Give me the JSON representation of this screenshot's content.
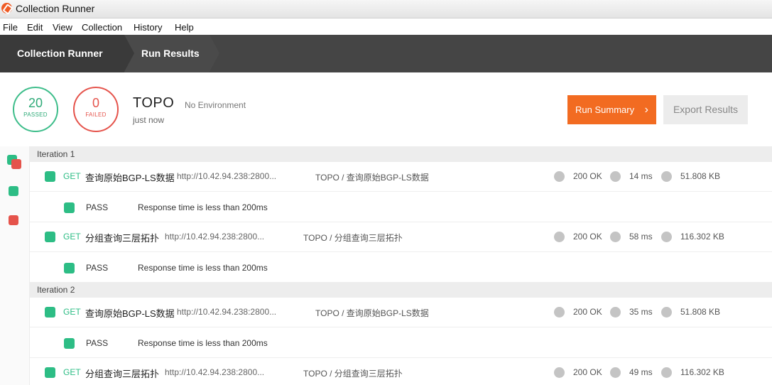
{
  "window": {
    "title": "Collection Runner"
  },
  "menu": [
    "File",
    "Edit",
    "View",
    "Collection",
    "History",
    "Help"
  ],
  "breadcrumbs": [
    "Collection Runner",
    "Run Results"
  ],
  "summary": {
    "passed_count": "20",
    "passed_label": "PASSED",
    "failed_count": "0",
    "failed_label": "FAILED",
    "collection": "TOPO",
    "environment": "No Environment",
    "time": "just now",
    "run_summary_label": "Run Summary",
    "export_label": "Export Results"
  },
  "colors": {
    "accent": "#f26b21",
    "pass": "#2dbd85",
    "fail": "#e5534b",
    "header": "#454545"
  },
  "iterations": [
    {
      "label": "Iteration 1",
      "requests": [
        {
          "method": "GET",
          "name": "查询原始BGP-LS数据",
          "url": "http://10.42.94.238:2800...",
          "path": "TOPO / 查询原始BGP-LS数据",
          "status": "200 OK",
          "time": "14 ms",
          "size": "51.808 KB",
          "test": {
            "result": "PASS",
            "desc": "Response time is less than 200ms"
          }
        },
        {
          "method": "GET",
          "name": "分组查询三层拓扑",
          "url": "http://10.42.94.238:2800...",
          "path": "TOPO / 分组查询三层拓扑",
          "status": "200 OK",
          "time": "58 ms",
          "size": "116.302 KB",
          "test": {
            "result": "PASS",
            "desc": "Response time is less than 200ms"
          }
        }
      ]
    },
    {
      "label": "Iteration 2",
      "requests": [
        {
          "method": "GET",
          "name": "查询原始BGP-LS数据",
          "url": "http://10.42.94.238:2800...",
          "path": "TOPO / 查询原始BGP-LS数据",
          "status": "200 OK",
          "time": "35 ms",
          "size": "51.808 KB",
          "test": {
            "result": "PASS",
            "desc": "Response time is less than 200ms"
          }
        },
        {
          "method": "GET",
          "name": "分组查询三层拓扑",
          "url": "http://10.42.94.238:2800...",
          "path": "TOPO / 分组查询三层拓扑",
          "status": "200 OK",
          "time": "49 ms",
          "size": "116.302 KB"
        }
      ]
    }
  ]
}
